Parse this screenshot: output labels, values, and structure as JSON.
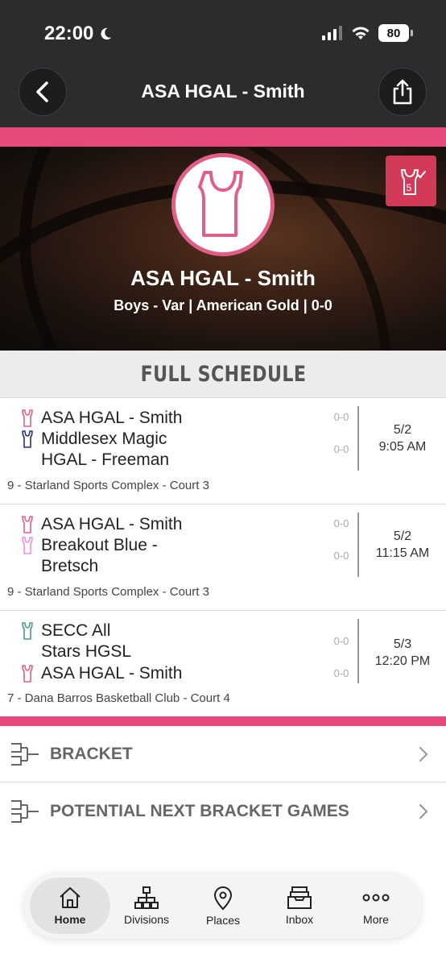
{
  "status_bar": {
    "time": "22:00",
    "battery": "80"
  },
  "nav": {
    "title": "ASA HGAL - Smith"
  },
  "hero": {
    "badge_number": "5",
    "team_name": "ASA HGAL - Smith",
    "team_subtitle": "Boys - Var | American Gold | 0-0"
  },
  "schedule": {
    "header": "FULL SCHEDULE",
    "games": [
      {
        "teams": [
          {
            "name": "ASA HGAL - Smith",
            "color": "#e05f86",
            "score": "0-0"
          },
          {
            "name": "Middlesex Magic HGAL - Freeman",
            "color": "#2b2f7a",
            "score": "0-0"
          }
        ],
        "date": "5/2",
        "time": "9:05 AM",
        "venue": "9 - Starland Sports Complex - Court 3"
      },
      {
        "teams": [
          {
            "name": "ASA HGAL - Smith",
            "color": "#e05f86",
            "score": "0-0"
          },
          {
            "name": "Breakout Blue - Bretsch",
            "color": "#ee8fe0",
            "score": "0-0"
          }
        ],
        "date": "5/2",
        "time": "11:15 AM",
        "venue": "9 - Starland Sports Complex - Court 3"
      },
      {
        "teams": [
          {
            "name": "SECC All Stars HGSL",
            "color": "#4a9a86",
            "score": "0-0"
          },
          {
            "name": "ASA HGAL - Smith",
            "color": "#e05f86",
            "score": "0-0"
          }
        ],
        "date": "5/3",
        "time": "12:20 PM",
        "venue": "7  - Dana Barros Basketball Club - Court 4"
      }
    ]
  },
  "menu": {
    "bracket": "BRACKET",
    "potential": "POTENTIAL NEXT BRACKET GAMES"
  },
  "tabs": [
    {
      "label": "Home",
      "icon": "home-icon",
      "active": true
    },
    {
      "label": "Divisions",
      "icon": "divisions-icon"
    },
    {
      "label": "Places",
      "icon": "location-pin-icon"
    },
    {
      "label": "Inbox",
      "icon": "inbox-icon"
    },
    {
      "label": "More",
      "icon": "more-dots-icon"
    }
  ],
  "colors": {
    "accent": "#e7497a",
    "header_dark": "#2a2c2e",
    "badge": "#d23a57"
  }
}
